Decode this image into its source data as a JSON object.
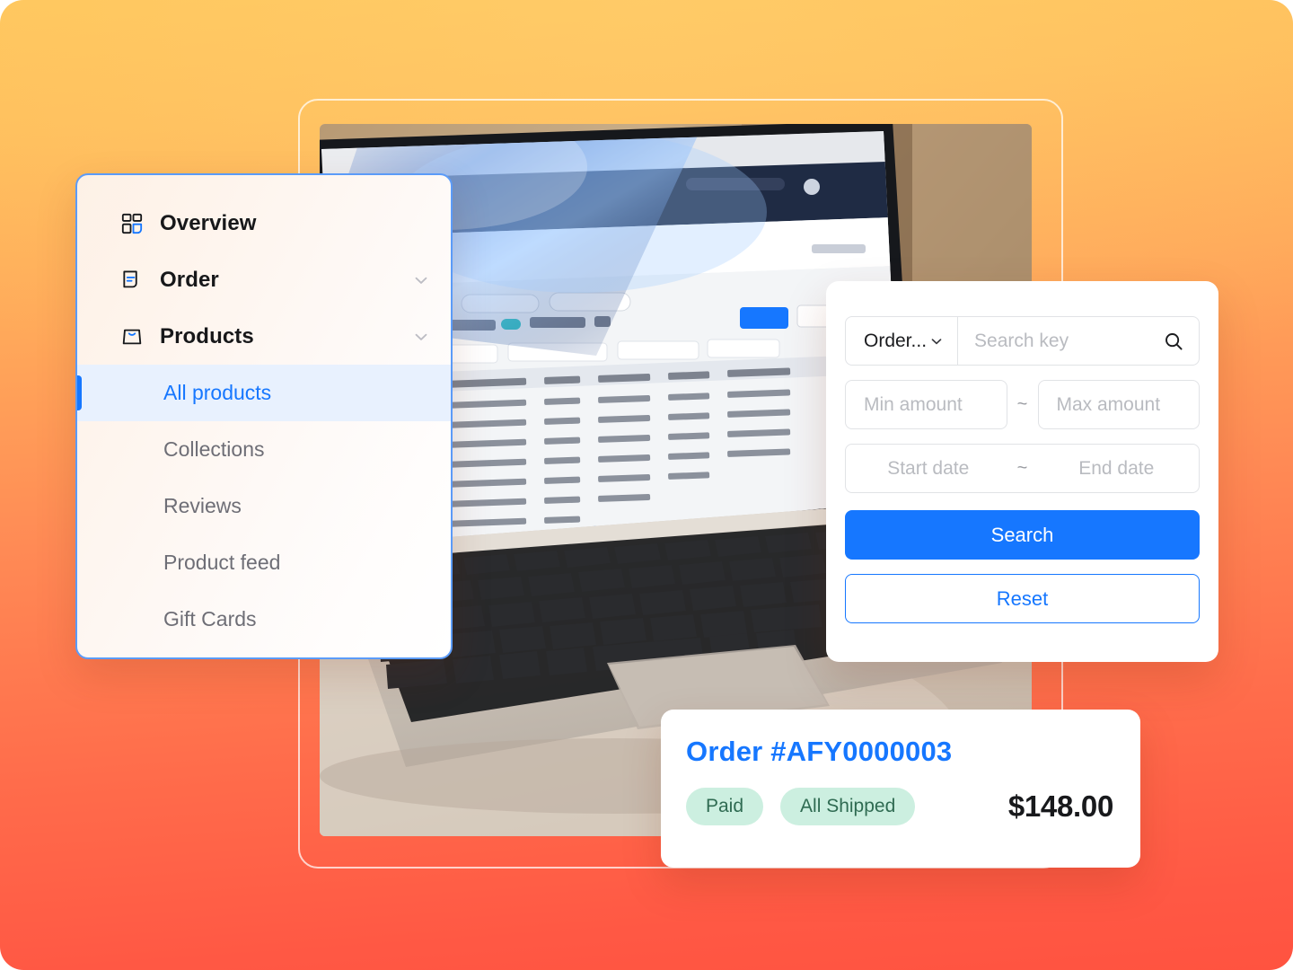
{
  "theme": {
    "background_top": "#FFC65C",
    "background_bottom": "#FF5340",
    "accent_blue": "#1677FF",
    "badge_bg": "#CCEFE0",
    "badge_text": "#2F6B52",
    "sidebar_border": "#5B9BF8",
    "active_item_bg": "#E8F1FE"
  },
  "sidebar": {
    "items": [
      {
        "label": "Overview",
        "icon": "dashboard-grid-icon",
        "expandable": false,
        "active": false
      },
      {
        "label": "Order",
        "icon": "document-lines-icon",
        "expandable": true,
        "chevron": "chevron-down-icon",
        "active": false
      },
      {
        "label": "Products",
        "icon": "shopping-bag-icon",
        "expandable": true,
        "chevron": "chevron-down-icon",
        "active": false
      }
    ],
    "sub_items": [
      {
        "label": "All products",
        "active": true
      },
      {
        "label": "Collections",
        "active": false
      },
      {
        "label": "Reviews",
        "active": false
      },
      {
        "label": "Product feed",
        "active": false
      },
      {
        "label": "Gift Cards",
        "active": false
      }
    ]
  },
  "search_panel": {
    "scope_select": {
      "value": "Order...",
      "chevron": "chevron-down-icon"
    },
    "search_key": {
      "placeholder": "Search key",
      "value": "",
      "icon": "search-icon"
    },
    "min_amount": {
      "placeholder": "Min amount",
      "value": ""
    },
    "max_amount": {
      "placeholder": "Max amount",
      "value": ""
    },
    "amount_separator": "~",
    "start_date": {
      "placeholder": "Start date",
      "value": ""
    },
    "end_date": {
      "placeholder": "End date",
      "value": ""
    },
    "date_separator": "~",
    "search_button": "Search",
    "reset_button": "Reset"
  },
  "order_card": {
    "order_id": "Order #AFY0000003",
    "payment_status": "Paid",
    "shipping_status": "All Shipped",
    "amount": "$148.00"
  },
  "photo": {
    "alt": "hands typing on a laptop displaying an order management dashboard"
  }
}
